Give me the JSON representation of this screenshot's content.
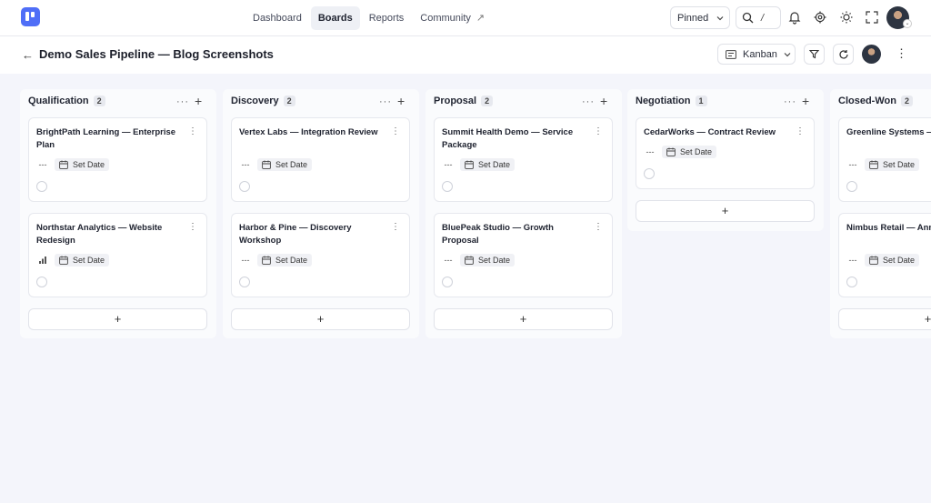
{
  "nav": {
    "items": [
      "Dashboard",
      "Boards",
      "Reports",
      "Community"
    ],
    "active": "Boards",
    "community_icon": "external-link-icon"
  },
  "toolbar": {
    "pinned_label": "Pinned",
    "search_shortcut": "/"
  },
  "header": {
    "title": "Demo Sales Pipeline — Blog Screenshots",
    "view_label": "Kanban"
  },
  "columns": [
    {
      "title": "Qualification",
      "count": "2",
      "cards": [
        {
          "title": "BrightPath Learning — Enterprise Plan",
          "priority_icon": "no-priority-icon",
          "date_label": "Set Date"
        },
        {
          "title": "Northstar Analytics — Website Redesign",
          "priority_icon": "priority-bars-icon",
          "date_label": "Set Date"
        }
      ]
    },
    {
      "title": "Discovery",
      "count": "2",
      "cards": [
        {
          "title": "Vertex Labs — Integration Review",
          "priority_icon": "no-priority-icon",
          "date_label": "Set Date"
        },
        {
          "title": "Harbor & Pine — Discovery Workshop",
          "priority_icon": "no-priority-icon",
          "date_label": "Set Date"
        }
      ]
    },
    {
      "title": "Proposal",
      "count": "2",
      "cards": [
        {
          "title": "Summit Health Demo — Service Package",
          "priority_icon": "no-priority-icon",
          "date_label": "Set Date"
        },
        {
          "title": "BluePeak Studio — Growth Proposal",
          "priority_icon": "no-priority-icon",
          "date_label": "Set Date"
        }
      ]
    },
    {
      "title": "Negotiation",
      "count": "1",
      "cards": [
        {
          "title": "CedarWorks — Contract Review",
          "priority_icon": "no-priority-icon",
          "date_label": "Set Date"
        }
      ]
    },
    {
      "title": "Closed-Won",
      "count": "2",
      "cards": [
        {
          "title": "Greenline Systems — Package",
          "priority_icon": "no-priority-icon",
          "date_label": "Set Date"
        },
        {
          "title": "Nimbus Retail — Annual Partnership",
          "priority_icon": "no-priority-icon",
          "date_label": "Set Date"
        }
      ]
    }
  ],
  "colors": {
    "brand": "#4f6ef7",
    "background": "#f4f5fb",
    "card": "#ffffff"
  }
}
